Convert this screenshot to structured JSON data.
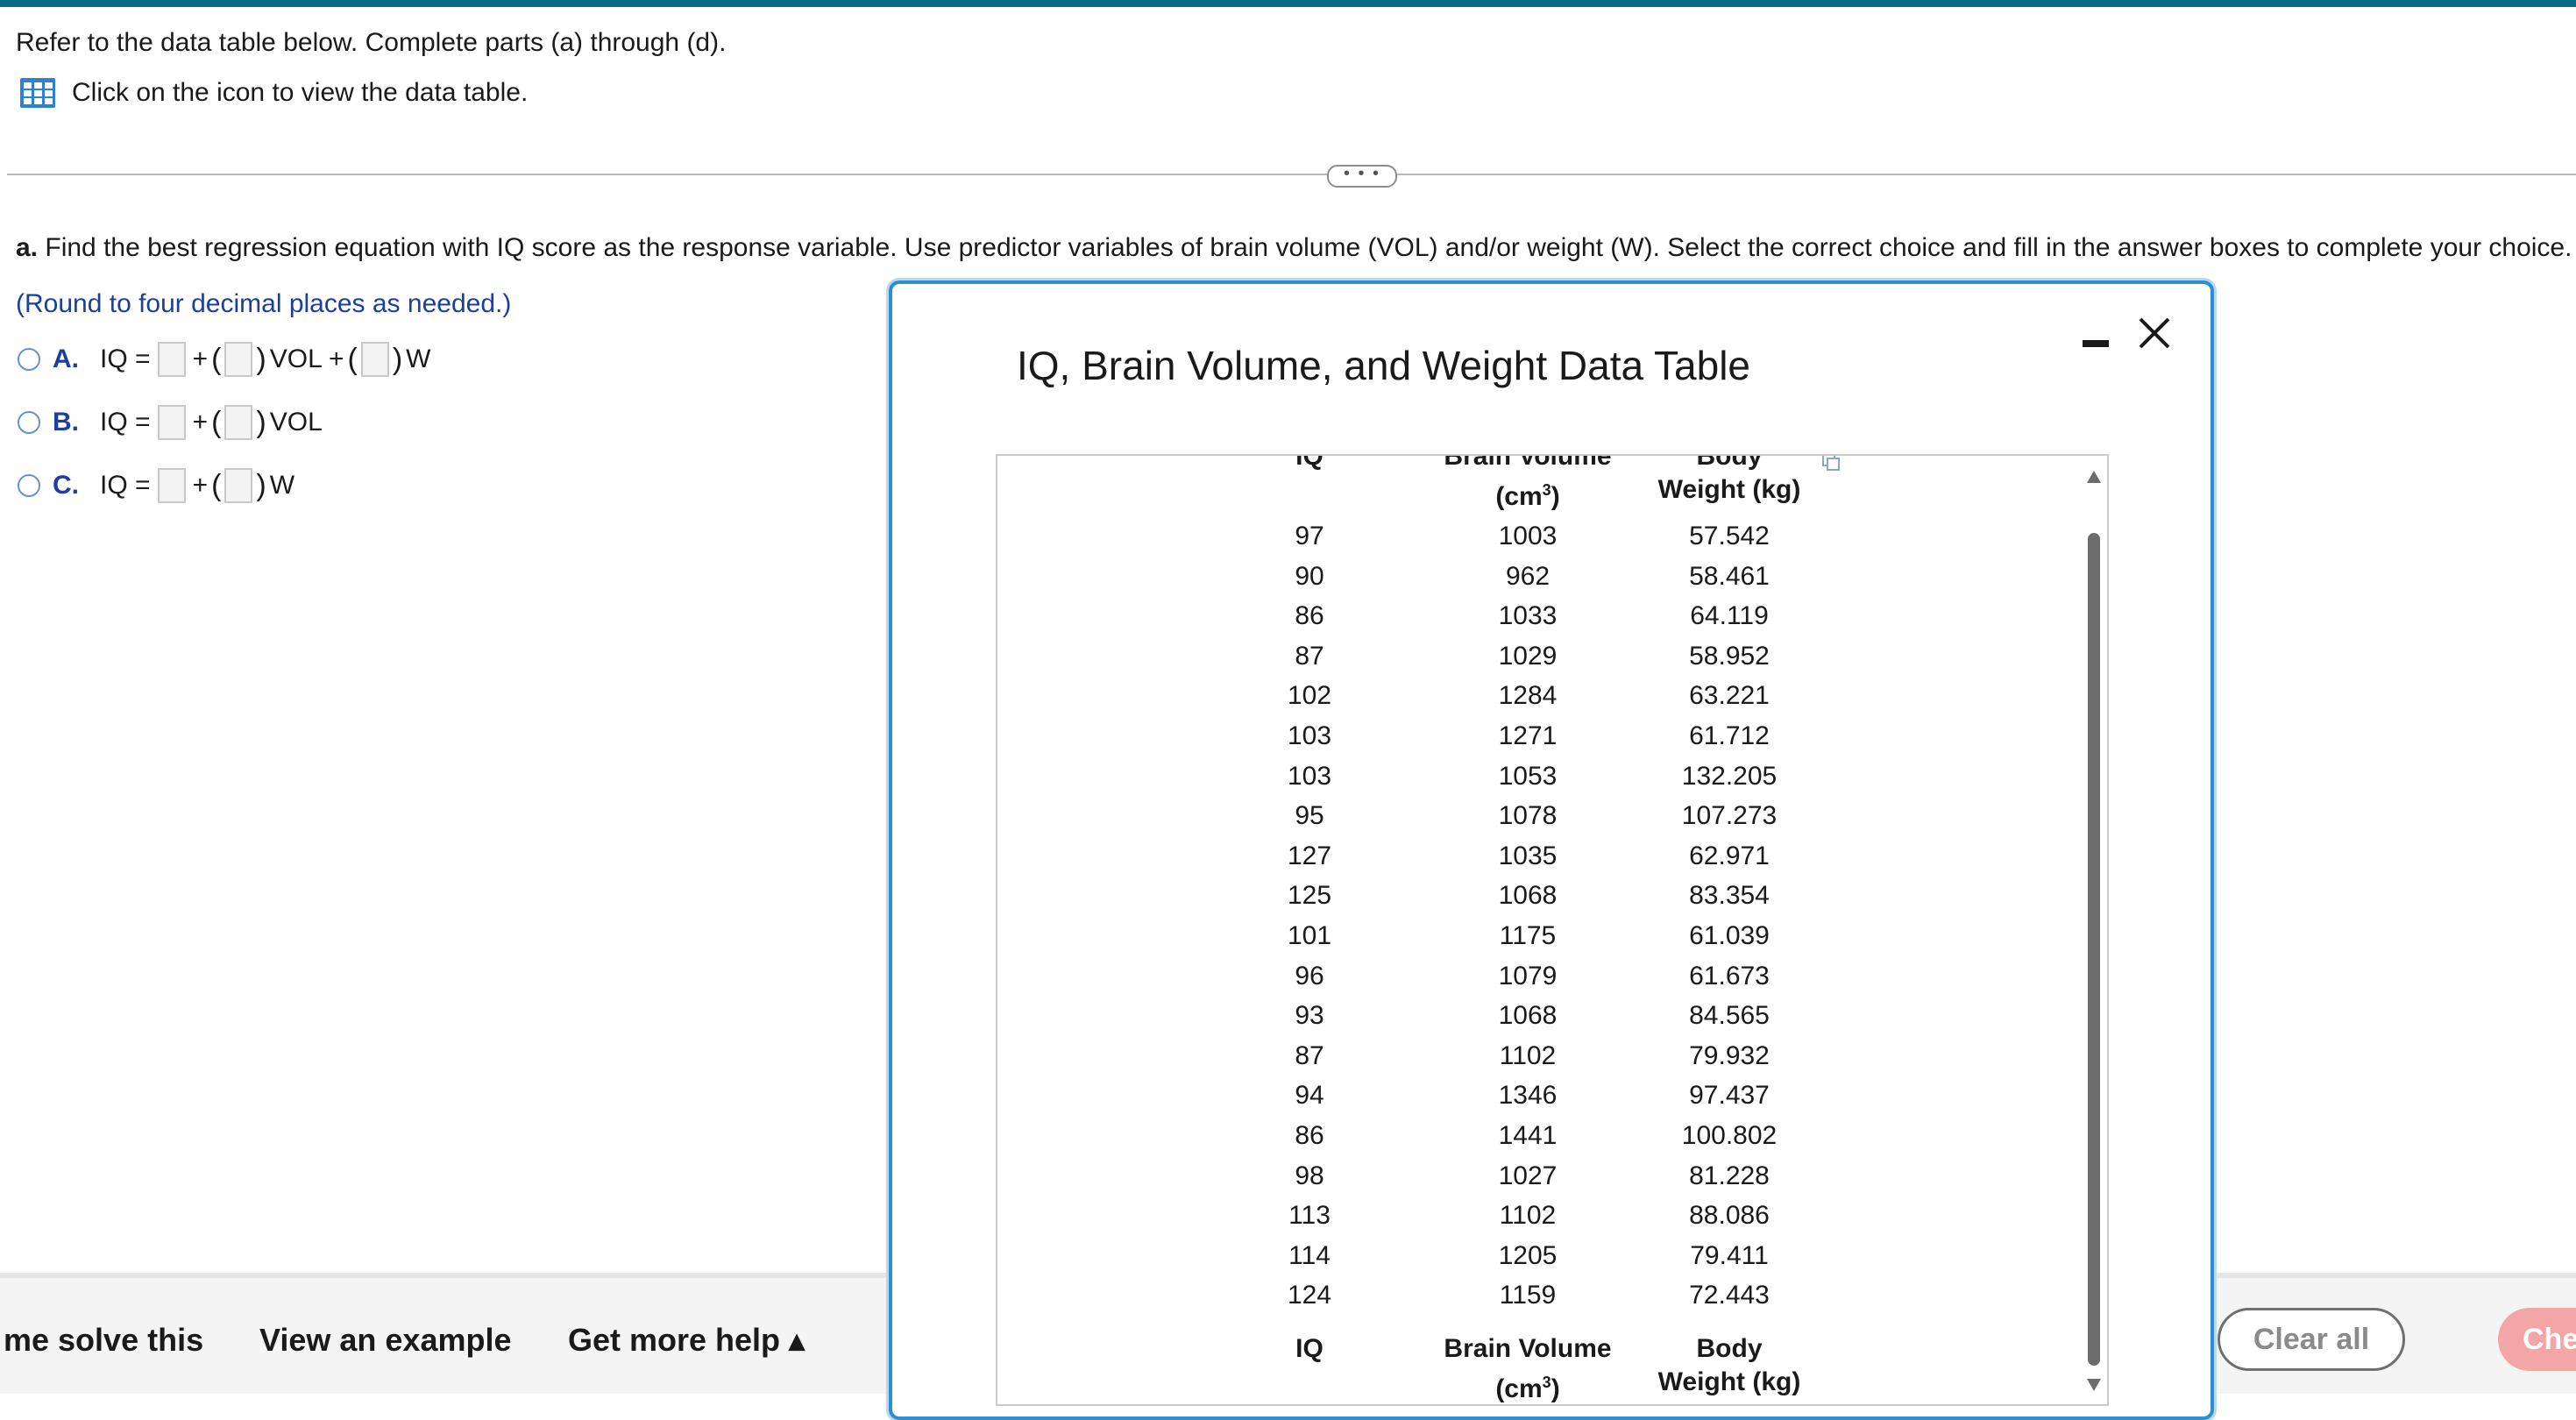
{
  "intro": {
    "instruction": "Refer to the data table below. Complete parts (a) through (d).",
    "link_text": "Click on the icon to view the data table."
  },
  "expander": {
    "label": "• • •"
  },
  "part_a": {
    "prefix": "a.",
    "question": "Find the best regression equation with IQ score as the response variable. Use predictor variables of brain volume (VOL) and/or weight (W). Select the correct choice and fill in the answer boxes to complete your choice.",
    "round_note": "(Round to four decimal places as needed.)",
    "choices": [
      {
        "letter": "A.",
        "lhs": "IQ =",
        "plus": "+",
        "terms": [
          "VOL +",
          "W"
        ]
      },
      {
        "letter": "B.",
        "lhs": "IQ =",
        "plus": "+",
        "terms": [
          "VOL"
        ]
      },
      {
        "letter": "C.",
        "lhs": "IQ =",
        "plus": "+",
        "terms": [
          "W"
        ]
      }
    ]
  },
  "bottom": {
    "help_me": "me solve this",
    "view_example": "View an example",
    "more_help": "Get more help ▴",
    "clear_all": "Clear all",
    "check": "Che"
  },
  "modal": {
    "title": "IQ, Brain Volume, and Weight Data Table",
    "columns": {
      "iq": "IQ",
      "vol_line1": "Brain Volume",
      "vol_line2": "(cm",
      "vol_sup": "3",
      "vol_close": ")",
      "wt_line1": "Body",
      "wt_line2": "Weight (kg)"
    },
    "top_header_partial": {
      "iq": "IQ",
      "vol": "Brain Volume",
      "wt": "Body"
    },
    "rows": [
      [
        "97",
        "1003",
        "57.542"
      ],
      [
        "90",
        "962",
        "58.461"
      ],
      [
        "86",
        "1033",
        "64.119"
      ],
      [
        "87",
        "1029",
        "58.952"
      ],
      [
        "102",
        "1284",
        "63.221"
      ],
      [
        "103",
        "1271",
        "61.712"
      ],
      [
        "103",
        "1053",
        "132.205"
      ],
      [
        "95",
        "1078",
        "107.273"
      ],
      [
        "127",
        "1035",
        "62.971"
      ],
      [
        "125",
        "1068",
        "83.354"
      ],
      [
        "101",
        "1175",
        "61.039"
      ],
      [
        "96",
        "1079",
        "61.673"
      ],
      [
        "93",
        "1068",
        "84.565"
      ],
      [
        "87",
        "1102",
        "79.932"
      ],
      [
        "94",
        "1346",
        "97.437"
      ],
      [
        "86",
        "1441",
        "100.802"
      ],
      [
        "98",
        "1027",
        "81.228"
      ],
      [
        "113",
        "1102",
        "88.086"
      ],
      [
        "114",
        "1205",
        "79.411"
      ],
      [
        "124",
        "1159",
        "72.443"
      ]
    ]
  },
  "colors": {
    "accent": "#0b6b86",
    "modal_border": "#2e8fd0",
    "choice_blue": "#1a3f9e",
    "check_button": "#f2a6a6"
  }
}
